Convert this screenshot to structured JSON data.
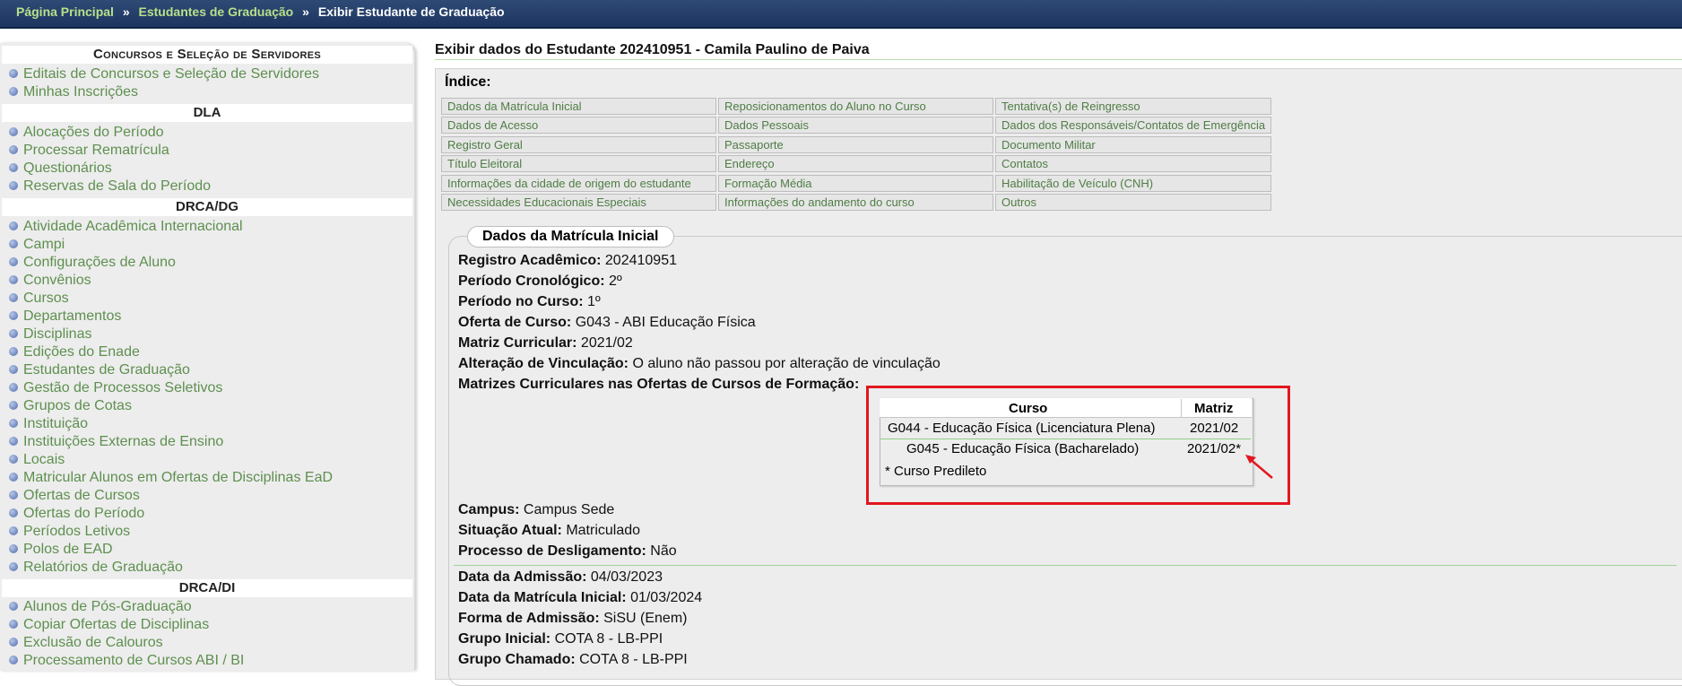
{
  "breadcrumb": {
    "items": [
      "Página Principal",
      "Estudantes de Graduação"
    ],
    "separator": "»",
    "current": "Exibir Estudante de Graduação"
  },
  "sidebar": {
    "sections": [
      {
        "title": "Concursos e Seleção de Servidores",
        "items": [
          "Editais de Concursos e Seleção de Servidores",
          "Minhas Inscrições"
        ]
      },
      {
        "title": "DLA",
        "items": [
          "Alocações do Período",
          "Processar Rematrícula",
          "Questionários",
          "Reservas de Sala do Período"
        ]
      },
      {
        "title": "DRCA/DG",
        "items": [
          "Atividade Acadêmica Internacional",
          "Campi",
          "Configurações de Aluno",
          "Convênios",
          "Cursos",
          "Departamentos",
          "Disciplinas",
          "Edições do Enade",
          "Estudantes de Graduação",
          "Gestão de Processos Seletivos",
          "Grupos de Cotas",
          "Instituição",
          "Instituições Externas de Ensino",
          "Locais",
          "Matricular Alunos em Ofertas de Disciplinas EaD",
          "Ofertas de Cursos",
          "Ofertas do Período",
          "Períodos Letivos",
          "Polos de EAD",
          "Relatórios de Graduação"
        ]
      },
      {
        "title": "DRCA/DI",
        "items": [
          "Alunos de Pós-Graduação",
          "Copiar Ofertas de Disciplinas",
          "Exclusão de Calouros",
          "Processamento de Cursos ABI / BI"
        ]
      }
    ]
  },
  "main": {
    "title": "Exibir dados do Estudante 202410951 - Camila Paulino de Paiva",
    "index_label": "Índice:",
    "index_links": [
      [
        "Dados da Matrícula Inicial",
        "Reposicionamentos do Aluno no Curso",
        "Tentativa(s) de Reingresso"
      ],
      [
        "Dados de Acesso",
        "Dados Pessoais",
        "Dados dos Responsáveis/Contatos de Emergência"
      ],
      [
        "Registro Geral",
        "Passaporte",
        "Documento Militar"
      ],
      [
        "Título Eleitoral",
        "Endereço",
        "Contatos"
      ],
      [
        "Informações da cidade de origem do estudante",
        "Formação Média",
        "Habilitação de Veículo (CNH)"
      ],
      [
        "Necessidades Educacionais Especiais",
        "Informações do andamento do curso",
        "Outros"
      ]
    ],
    "section_title": "Dados da Matrícula Inicial",
    "fields_a": [
      {
        "label": "Registro Acadêmico:",
        "value": "202410951"
      },
      {
        "label": "Período Cronológico:",
        "value": "2º"
      },
      {
        "label": "Período no Curso:",
        "value": "1º"
      },
      {
        "label": "Oferta de Curso:",
        "value": "G043 - ABI Educação Física"
      },
      {
        "label": "Matriz Curricular:",
        "value": "2021/02"
      },
      {
        "label": "Alteração de Vinculação:",
        "value": "O aluno não passou por alteração de vinculação"
      },
      {
        "label": "Matrizes Curriculares nas Ofertas de Cursos de Formação:",
        "value": ""
      }
    ],
    "matrices": {
      "col_curso": "Curso",
      "col_matriz": "Matriz",
      "rows": [
        {
          "curso": "G044 - Educação Física (Licenciatura Plena)",
          "matriz": "2021/02"
        },
        {
          "curso": "G045 - Educação Física (Bacharelado)",
          "matriz": "2021/02*"
        }
      ],
      "footnote": "* Curso Predileto"
    },
    "fields_b": [
      {
        "label": "Campus:",
        "value": "Campus Sede"
      },
      {
        "label": "Situação Atual:",
        "value": "Matriculado"
      },
      {
        "label": "Processo de Desligamento:",
        "value": "Não"
      }
    ],
    "fields_c": [
      {
        "label": "Data da Admissão:",
        "value": "04/03/2023"
      },
      {
        "label": "Data da Matrícula Inicial:",
        "value": "01/03/2024"
      },
      {
        "label": "Forma de Admissão:",
        "value": "SiSU (Enem)"
      },
      {
        "label": "Grupo Inicial:",
        "value": "COTA 8 - LB-PPI"
      },
      {
        "label": "Grupo Chamado:",
        "value": "COTA 8 - LB-PPI"
      }
    ]
  },
  "colors": {
    "annotation_red": "#e3161e",
    "link_green": "#5e8f4f",
    "topbar_blue": "#1d3560"
  }
}
